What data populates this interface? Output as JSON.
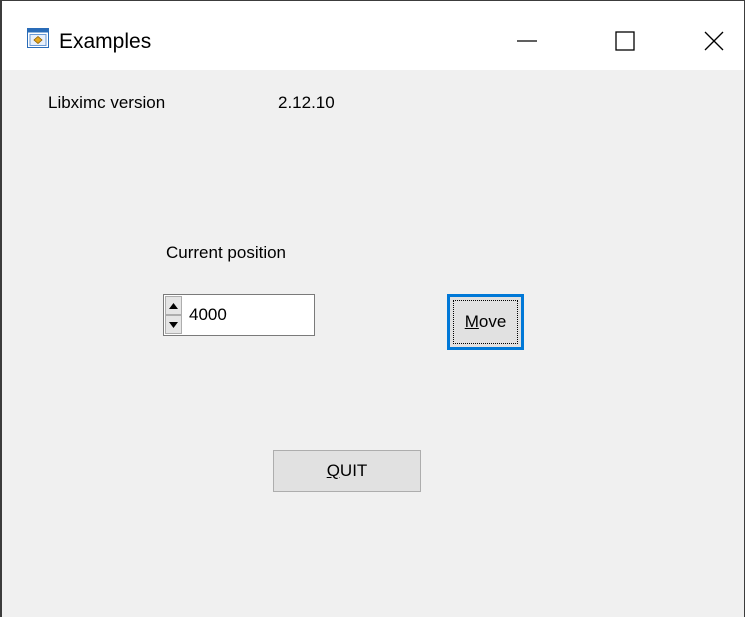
{
  "window": {
    "title": "Examples",
    "icon": "app-window-icon",
    "controls": {
      "minimize": "minimize-icon",
      "maximize": "maximize-icon",
      "close": "close-icon"
    }
  },
  "info": {
    "version_label": "Libximc version",
    "version_value": "2.12.10"
  },
  "position": {
    "label": "Current position",
    "value": "4000"
  },
  "buttons": {
    "move": {
      "mnemonic": "M",
      "rest": "ove"
    },
    "quit": {
      "mnemonic": "Q",
      "rest": "UIT"
    }
  },
  "colors": {
    "focus_border": "#0078d7",
    "client_bg": "#f0f0f0",
    "button_bg": "#e1e1e1"
  }
}
